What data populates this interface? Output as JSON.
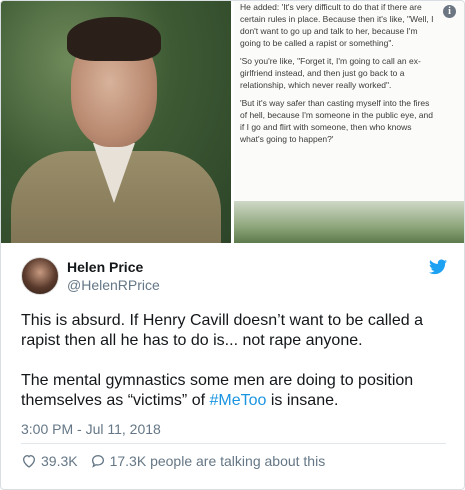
{
  "media": {
    "article_paragraphs": [
      "He added: 'It's very difficult to do that if there are certain rules in place. Because then it's like, \"Well, I don't want to go up and talk to her, because I'm going to be called a rapist or something\".",
      "'So you're like, \"Forget it, I'm going to call an ex-girlfriend instead, and then just go back to a relationship, which never really worked\".",
      "'But it's way safer than casting myself into the fires of hell, because I'm someone in the public eye, and if I go and flirt with someone, then who knows what's going to happen?'"
    ],
    "info_icon": "info-icon"
  },
  "author": {
    "name": "Helen Price",
    "handle": "@HelenRPrice",
    "avatar_icon": "avatar"
  },
  "tweet": {
    "paragraph1": "This is absurd. If Henry Cavill doesn’t want to be called a rapist then all he has to do is... not rape anyone.",
    "paragraph2_pre": "The mental gymnastics some men are doing to position themselves as “victims” of ",
    "hashtag": "#MeToo",
    "paragraph2_post": " is insane."
  },
  "timestamp": "3:00 PM - Jul 11, 2018",
  "actions": {
    "likes": "39.3K",
    "replies": "17.3K",
    "talking_label": "people are talking about this"
  },
  "colors": {
    "accent": "#1b95e0",
    "secondary_text": "#657786",
    "primary_text": "#14171a"
  }
}
